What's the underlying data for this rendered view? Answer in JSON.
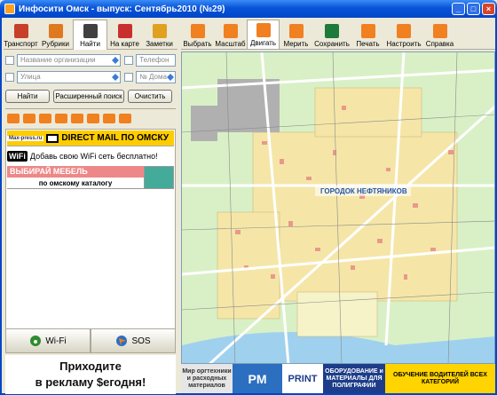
{
  "window": {
    "title": "Инфосити Омск - выпуск: Сентябрь2010 (№29)",
    "minimize": "_",
    "maximize": "□",
    "close": "×"
  },
  "left_tabs": [
    {
      "label": "Транспорт",
      "icon": "bus-icon",
      "color": "#C8402A"
    },
    {
      "label": "Рубрики",
      "icon": "list-icon",
      "color": "#E07820"
    },
    {
      "label": "Найти",
      "icon": "binoculars-icon",
      "color": "#404040"
    },
    {
      "label": "На карте",
      "icon": "map-pin-icon",
      "color": "#C83030"
    },
    {
      "label": "Заметки",
      "icon": "notes-icon",
      "color": "#E0A020"
    }
  ],
  "search": {
    "org_placeholder": "Название организации",
    "phone_placeholder": "Телефон",
    "street_placeholder": "Улица",
    "house_placeholder": "№ Дома",
    "find_label": "Найти",
    "advanced_label": "Расширенный поиск",
    "clear_label": "Очистить"
  },
  "ads": {
    "ad1_site": "Max-press.ru",
    "ad1_text": "DIRECT MAIL ПО ОМСКУ",
    "ad2_logo": "WiFi",
    "ad2_text": "Добавь свою WiFi сеть бесплатно!",
    "ad3_line1": "ВЫБИРАЙ МЕБЕЛЬ",
    "ad3_line2": "по омскому каталогу"
  },
  "bottom": {
    "wifi_label": "Wi-Fi",
    "sos_label": "SOS",
    "promo_line1": "Приходите",
    "promo_line2": "в рекламу $егодня!"
  },
  "tools": [
    {
      "label": "Выбрать",
      "icon": "cursor-icon",
      "color": "#F08020"
    },
    {
      "label": "Масштаб",
      "icon": "zoom-icon",
      "color": "#F08020"
    },
    {
      "label": "Двигать",
      "icon": "hand-icon",
      "color": "#F08020"
    },
    {
      "label": "Мерить",
      "icon": "ruler-icon",
      "color": "#F08020"
    },
    {
      "label": "Сохранить",
      "icon": "excel-icon",
      "color": "#1E7A3A"
    },
    {
      "label": "Печать",
      "icon": "printer-icon",
      "color": "#F08020"
    },
    {
      "label": "Настроить",
      "icon": "gear-icon",
      "color": "#F08020"
    },
    {
      "label": "Справка",
      "icon": "help-icon",
      "color": "#F08020"
    }
  ],
  "map": {
    "label": "ГОРОДОК НЕФТЯНИКОВ"
  },
  "banner": {
    "b1": "Мир оргтехники и расходных материалов",
    "b2": "PM",
    "b3": "PRINT",
    "b4": "ОБОРУДОВАНИЕ и МАТЕРИАЛЫ ДЛЯ ПОЛИГРАФИИ",
    "b5": "ОБУЧЕНИЕ ВОДИТЕЛЕЙ ВСЕХ КАТЕГОРИЙ"
  }
}
